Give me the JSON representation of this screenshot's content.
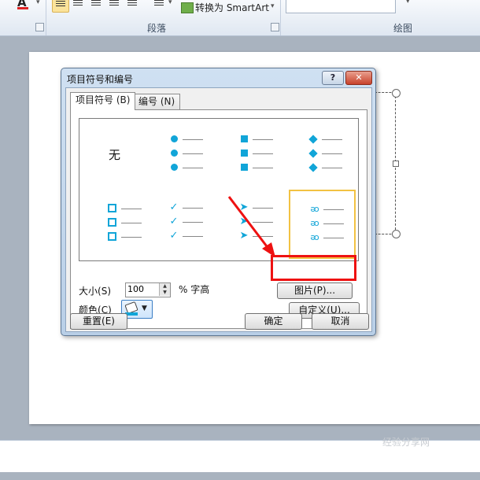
{
  "ribbon": {
    "convert_smartart": "转换为 SmartArt",
    "group_paragraph": "段落",
    "group_drawing": "绘图"
  },
  "dialog": {
    "title": "项目符号和编号",
    "help": "?",
    "close": "✕",
    "tabs": [
      {
        "label": "项目符号",
        "hotkey": "(B)",
        "active": true
      },
      {
        "label": "编号",
        "hotkey": "(N)",
        "active": false
      }
    ],
    "gallery": {
      "none_label": "无",
      "bullet_color": "#11a5d8",
      "styles": [
        "none",
        "filled-circle",
        "filled-square",
        "diamond",
        "hollow-square",
        "checkmark",
        "arrowhead",
        "picture-bullet"
      ],
      "selected": "picture-bullet"
    },
    "size_label": "大小",
    "size_hotkey": "(S)",
    "size_value": "100",
    "size_unit": "% 字高",
    "color_label": "颜色",
    "color_hotkey": "(C)",
    "picture_button": "图片",
    "picture_hotkey": "(P)...",
    "customize_button": "自定义",
    "customize_hotkey": "(U)...",
    "reset_button": "重置",
    "reset_hotkey": "(E)",
    "ok_button": "确定",
    "cancel_button": "取消"
  },
  "annotation": {
    "highlight_color": "#e11111"
  },
  "watermark": "经验分享网"
}
